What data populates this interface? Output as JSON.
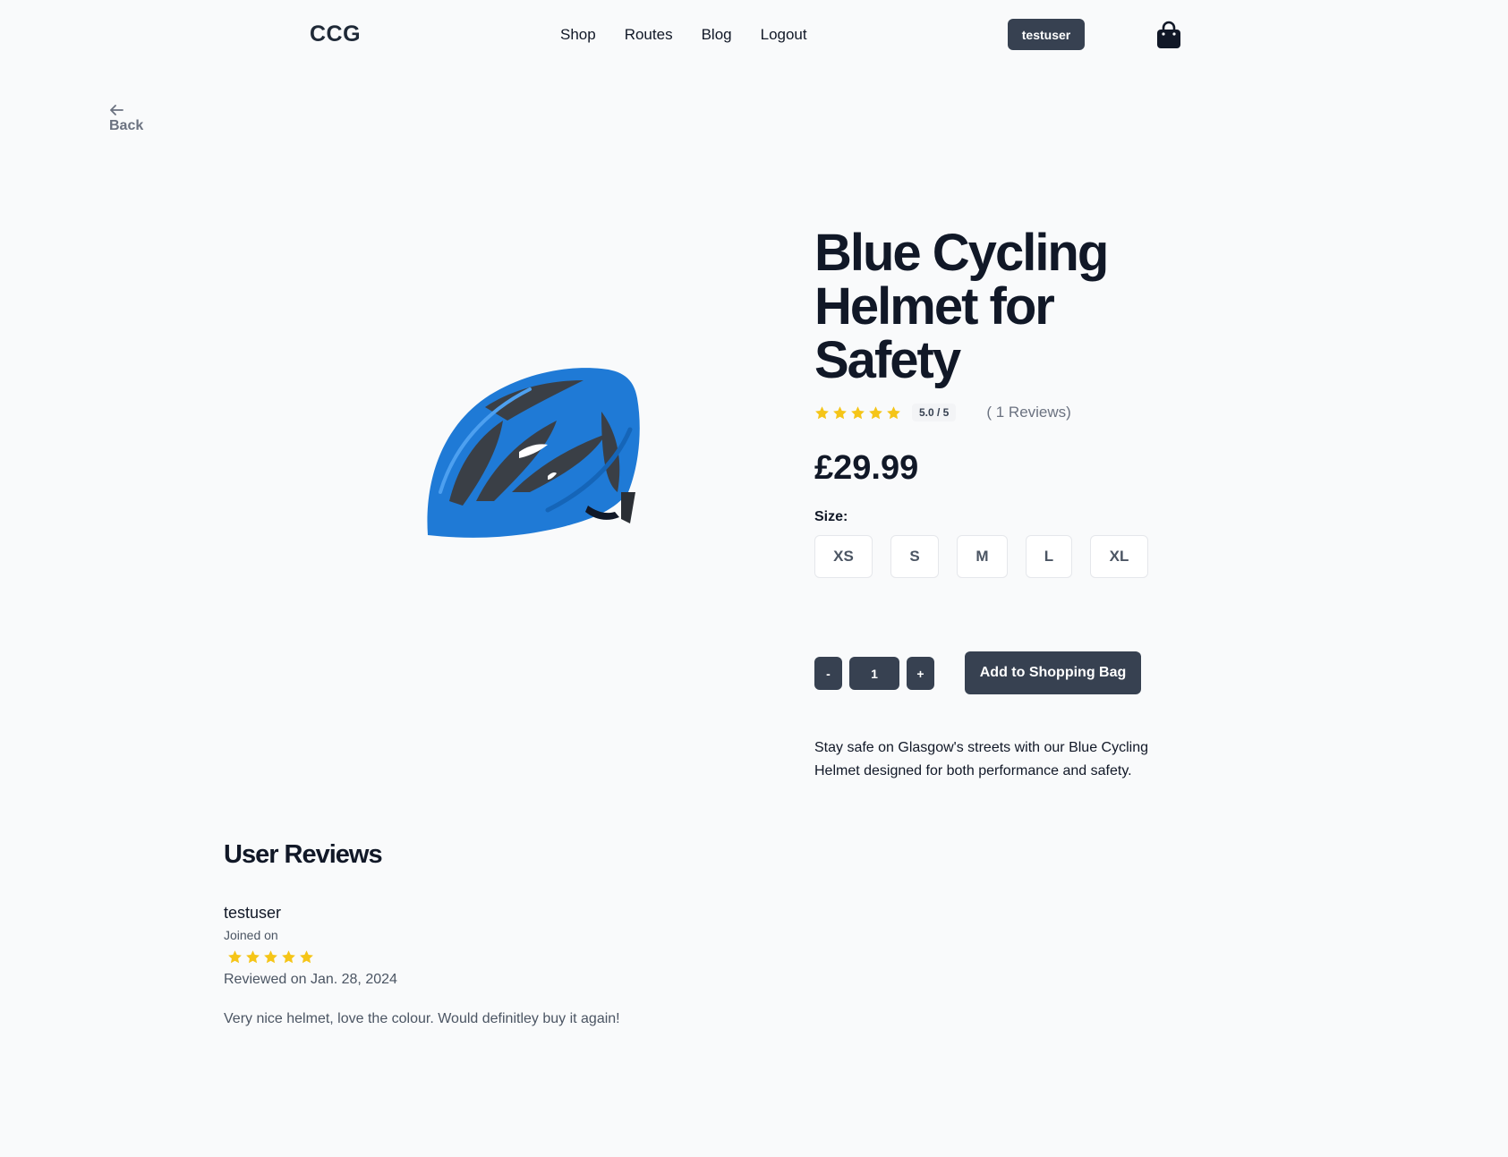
{
  "header": {
    "logo": "CCG",
    "nav": [
      "Shop",
      "Routes",
      "Blog",
      "Logout"
    ],
    "user_button": "testuser",
    "bag_icon": "shopping-bag-icon"
  },
  "back": {
    "label": "Back",
    "icon": "arrow-left-icon"
  },
  "product": {
    "title": "Blue Cycling Helmet for Safety",
    "rating_stars": 5,
    "rating_badge": "5.0 / 5",
    "reviews_count": "( 1 Reviews)",
    "price": "£29.99",
    "size_label": "Size:",
    "sizes": [
      "XS",
      "S",
      "M",
      "L",
      "XL"
    ],
    "quantity": {
      "minus": "-",
      "value": "1",
      "plus": "+"
    },
    "add_button": "Add to Shopping Bag",
    "description": "Stay safe on Glasgow's streets with our Blue Cycling Helmet designed for both performance and safety.",
    "image_icon": "bicycle-helmet-image"
  },
  "reviews": {
    "heading": "User Reviews",
    "items": [
      {
        "user": "testuser",
        "joined": "Joined on",
        "stars": 5,
        "date": "Reviewed on Jan. 28, 2024",
        "text": "Very nice helmet, love the colour. Would definitley buy it again!"
      }
    ]
  },
  "colors": {
    "background": "#f9fafb",
    "dark_button": "#374151",
    "star": "#f5c518",
    "helmet_blue": "#1f7ad6"
  }
}
